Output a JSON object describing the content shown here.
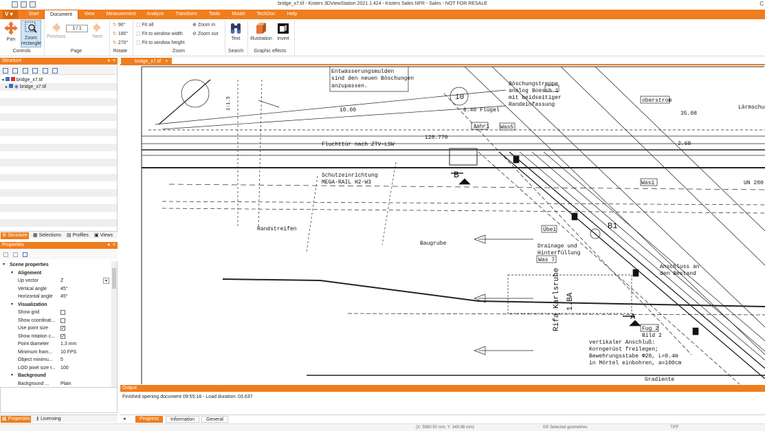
{
  "window": {
    "title": "bridge_x7.tif - Kisters 3DViewStation 2021.1.424 - Kisters Sales NFR - Sales - NOT FOR RESALE"
  },
  "menu": {
    "app_button": "V",
    "tabs": [
      "Start",
      "Document",
      "View",
      "Measurement",
      "Analyze",
      "Transform",
      "Tools",
      "Model",
      "TechDoc",
      "Help"
    ],
    "active": "Document"
  },
  "ribbon": {
    "pan": "Pan",
    "zoom_rect": "Zoom rectangle",
    "controls_group": "Controls",
    "page_value": "1 / 1",
    "previous": "Previous",
    "next": "Next",
    "page_group": "Page",
    "rot90": "90°",
    "rot180": "180°",
    "rot270": "270°",
    "rotate_group": "Rotate",
    "fit_all": "Fit all",
    "fit_width": "Fit to window width",
    "fit_height": "Fit to window height",
    "zoom_in": "Zoom in",
    "zoom_out": "Zoom out",
    "zoom_group": "Zoom",
    "text": "Text",
    "search_group": "Search",
    "illustration": "Illustration",
    "invert": "Invert",
    "graphic_group": "Graphic effects"
  },
  "structure": {
    "title": "Structure",
    "pin": "♦",
    "close": "×",
    "root": "bridge_x7.tif",
    "child": "bridge_x7.tif",
    "tabs": [
      "Structure",
      "Selections",
      "Profiles",
      "Views"
    ]
  },
  "properties": {
    "title": "Properties",
    "rows": [
      {
        "t": "grp",
        "k": "Scene properties"
      },
      {
        "t": "sub",
        "k": "Alignment"
      },
      {
        "t": "kv",
        "k": "Up vector",
        "v": "Z"
      },
      {
        "t": "kv",
        "k": "Vertical angle",
        "v": "45°"
      },
      {
        "t": "kv",
        "k": "Horizontal angle",
        "v": "45°"
      },
      {
        "t": "sub",
        "k": "Visualization"
      },
      {
        "t": "chk",
        "k": "Show grid",
        "v": ""
      },
      {
        "t": "chk",
        "k": "Show coordinat...",
        "v": ""
      },
      {
        "t": "chk",
        "k": "Use point size",
        "v": "✓"
      },
      {
        "t": "chk",
        "k": "Show rotation c...",
        "v": "✓"
      },
      {
        "t": "kv",
        "k": "Point diameter",
        "v": "1.3 mm"
      },
      {
        "t": "kv",
        "k": "Minimum fram...",
        "v": "10 FPS"
      },
      {
        "t": "kv",
        "k": "Object minimu...",
        "v": "5"
      },
      {
        "t": "kv",
        "k": "LOD pixel size t...",
        "v": "100"
      },
      {
        "t": "sub",
        "k": "Background"
      },
      {
        "t": "kv",
        "k": "Background ...",
        "v": "Plain"
      }
    ],
    "tabs": [
      "Properties",
      "Licensing"
    ]
  },
  "document": {
    "tab": "bridge_x7.tif"
  },
  "drawing": {
    "labels": [
      "Entwässerungsmulden",
      "sind den neuen Böschungen",
      "anzupassen.",
      "1:1.5",
      "10.00",
      "10",
      "6.40 Flügel",
      "Jahr1",
      "Was5",
      "128.770",
      "Fluchttür nach ZTV-LSW",
      "Schutzeinrichtung",
      "MEGA-RAIL H2-W3",
      "B",
      "Randstreifen",
      "Baugrube",
      "Übe1",
      "Drainage und",
      "Hinterfüllung",
      "Was 7",
      "B1",
      "Böschungstreppe",
      "analog",
      "Boesch 1",
      "mit beidseitiger",
      "Randeinfassung",
      "oberstrom",
      "35.08",
      "Lärmschut",
      "2.60",
      "Was1",
      "UN 200",
      "Anschluss an",
      "den Bestand",
      "Rifa Karlsruhe",
      "1.BA",
      "A",
      "Fug 2",
      "Bild 2",
      "vertikaler Anschluß:",
      "Korngerüst freilegen;",
      "Bewehrungsstabe Φ28, L=0.4m",
      "in Mörtel einbohren, a=100cm",
      "Gradiente"
    ]
  },
  "output": {
    "title": "Output",
    "message": "Finished opening document 09:55:18 - Load duration: 03.637",
    "tabs": [
      "Progress",
      "Information",
      "General"
    ]
  },
  "status": {
    "coords": "(X: 5980.50 mm, Y: 349.98 mm)",
    "selected": "0/0 Selected geometries",
    "format": "TIFF"
  }
}
